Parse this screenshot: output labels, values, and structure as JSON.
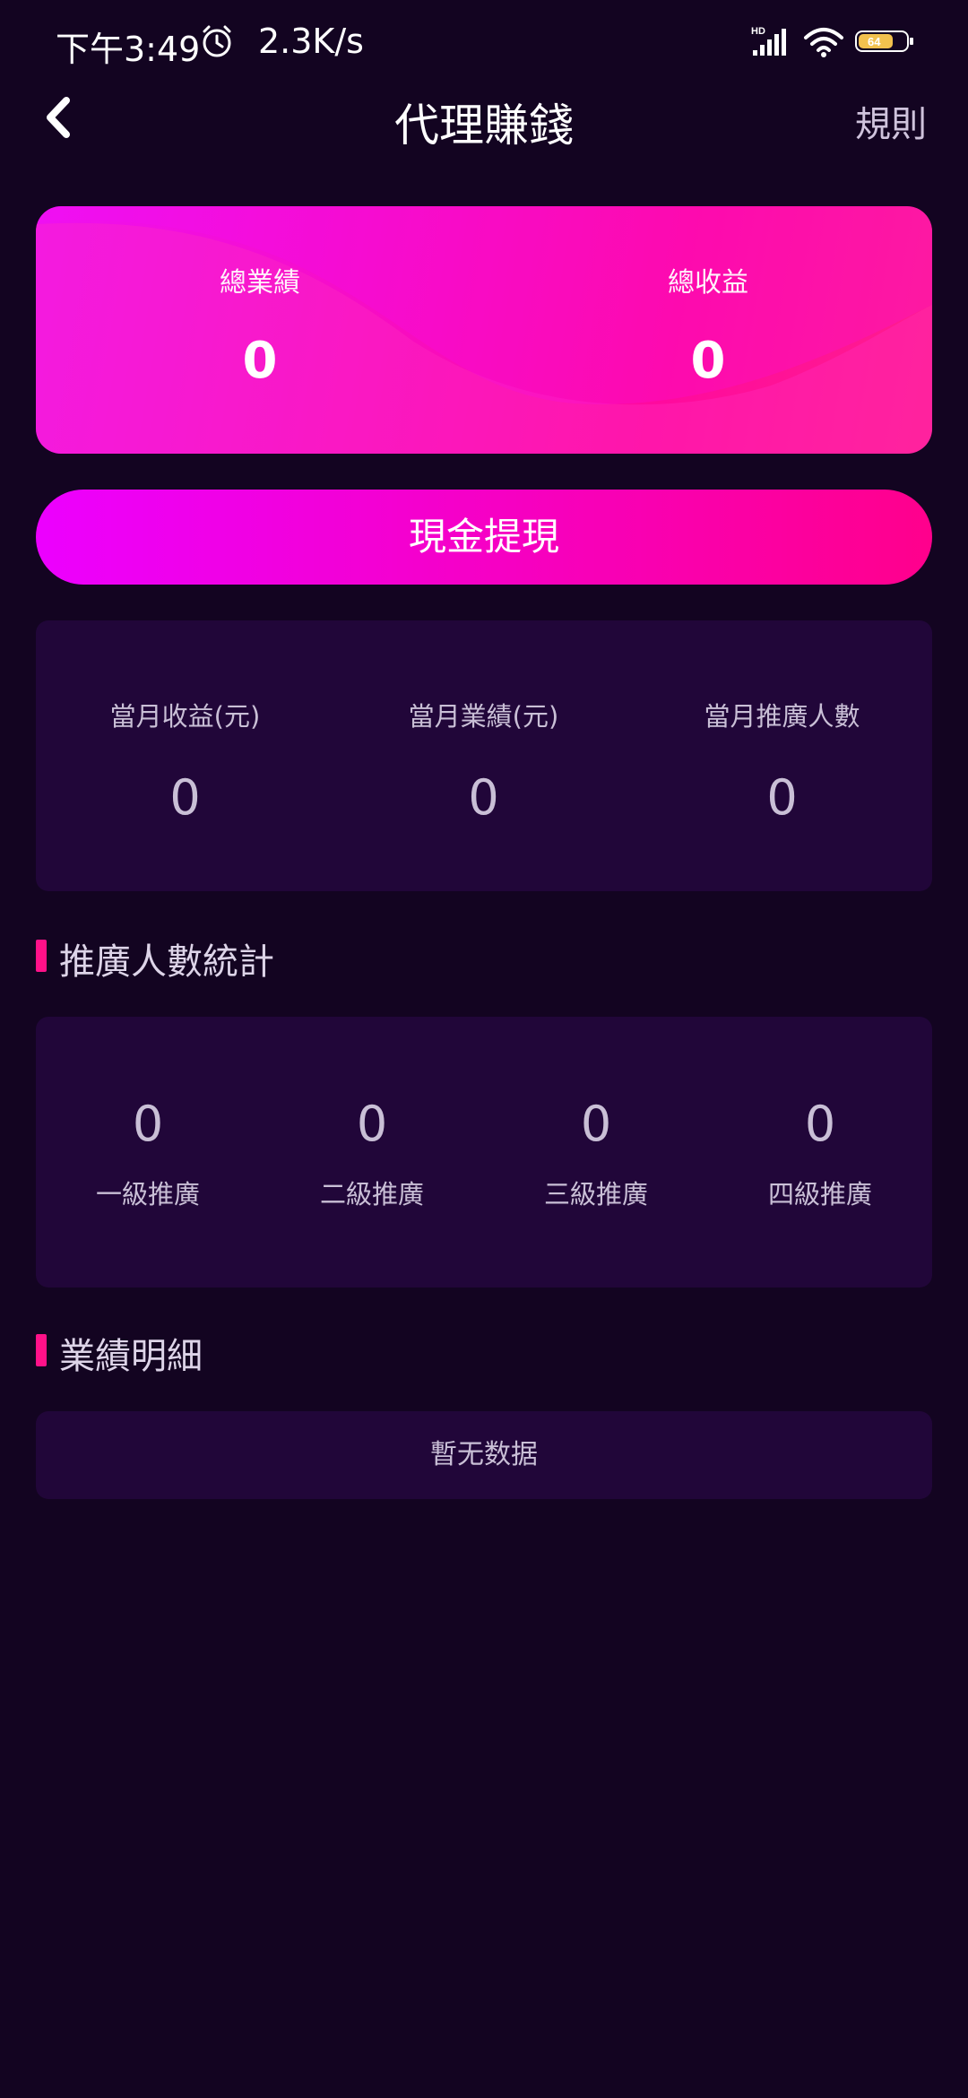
{
  "status_bar": {
    "time": "下午3:49",
    "network_speed": "2.3K/s",
    "battery_level": "64"
  },
  "nav": {
    "title": "代理賺錢",
    "rules_label": "規則"
  },
  "summary": {
    "total_performance_label": "總業績",
    "total_performance_value": "0",
    "total_earnings_label": "總收益",
    "total_earnings_value": "0"
  },
  "withdraw_button_label": "現金提現",
  "monthly": {
    "items": [
      {
        "label": "當月收益(元)",
        "value": "0"
      },
      {
        "label": "當月業績(元)",
        "value": "0"
      },
      {
        "label": "當月推廣人數",
        "value": "0"
      }
    ]
  },
  "promotion_stats": {
    "title": "推廣人數統計",
    "levels": [
      {
        "label": "一級推廣",
        "value": "0"
      },
      {
        "label": "二級推廣",
        "value": "0"
      },
      {
        "label": "三級推廣",
        "value": "0"
      },
      {
        "label": "四級推廣",
        "value": "0"
      }
    ]
  },
  "performance_details": {
    "title": "業績明細",
    "empty_text": "暫无数据"
  },
  "colors": {
    "background": "#130421",
    "panel": "#210639",
    "accent_pink": "#ff008c",
    "accent_magenta": "#ec00ff"
  }
}
